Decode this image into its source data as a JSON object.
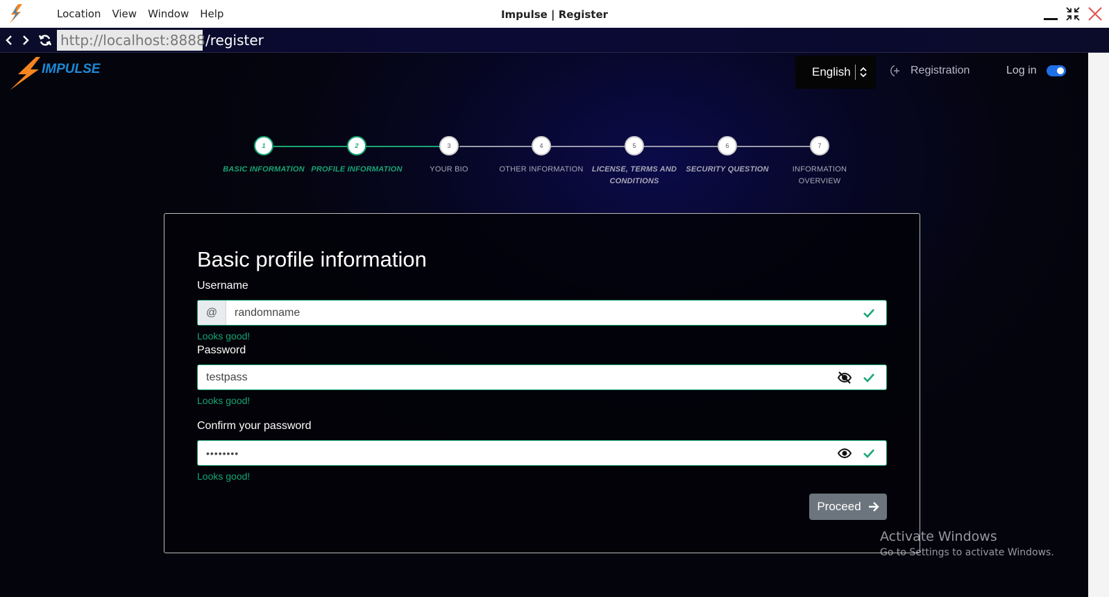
{
  "menu": {
    "items": [
      "Location",
      "View",
      "Window",
      "Help"
    ]
  },
  "window": {
    "title": "Impulse | Register"
  },
  "address": {
    "host": "http://localhost:8888",
    "path": "/register"
  },
  "header": {
    "brand_text": "IMPULSE",
    "language": "English",
    "registration_label": "Registration",
    "login_label": "Log in",
    "login_toggle_on": true
  },
  "stepper": {
    "current_step": 2,
    "steps": [
      {
        "number": "1",
        "label": "BASIC INFORMATION",
        "state": "complete"
      },
      {
        "number": "2",
        "label": "PROFILE INFORMATION",
        "state": "complete"
      },
      {
        "number": "3",
        "label": "YOUR BIO",
        "state": "pending"
      },
      {
        "number": "4",
        "label": "OTHER INFORMATION",
        "state": "pending"
      },
      {
        "number": "5",
        "label": "LICENSE, TERMS AND CONDITIONS",
        "state": "pending"
      },
      {
        "number": "6",
        "label": "SECURITY QUESTION",
        "state": "pending"
      },
      {
        "number": "7",
        "label": "INFORMATION OVERVIEW",
        "state": "pending"
      }
    ]
  },
  "form": {
    "title": "Basic profile information",
    "username": {
      "label": "Username",
      "prefix": "@",
      "value": "randomname",
      "feedback": "Looks good!"
    },
    "password": {
      "label": "Password",
      "value": "testpass",
      "feedback": "Looks good!"
    },
    "confirm_password": {
      "label": "Confirm your password",
      "value": "••••••••",
      "feedback": "Looks good!"
    },
    "proceed_label": "Proceed"
  },
  "watermark": {
    "line1": "Activate Windows",
    "line2": "Go to Settings to activate Windows."
  },
  "colors": {
    "accent_green": "#17a673",
    "toggle_blue": "#1f6fe5",
    "brand_orange": "#f5841f",
    "brand_blue": "#1b8ad6"
  }
}
